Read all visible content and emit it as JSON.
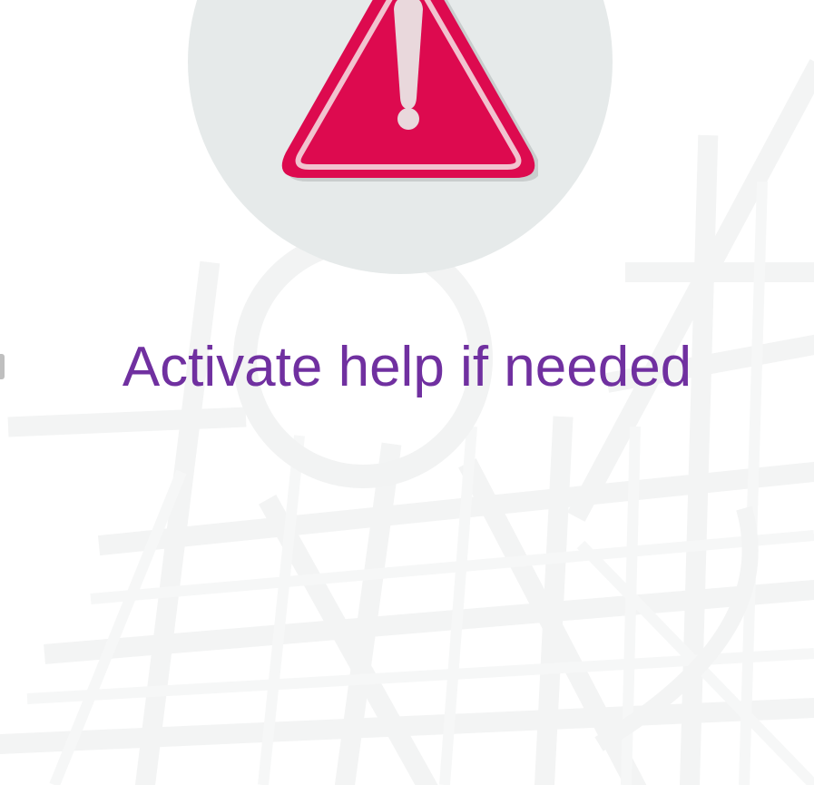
{
  "message": {
    "text": "Activate help if needed"
  },
  "icons": {
    "alert": "warning-triangle-icon"
  },
  "colors": {
    "alert_red": "#dd0a4f",
    "text_purple": "#7030a0",
    "circle_bg": "#e6eaea",
    "map_lines": "#f4f5f5"
  }
}
